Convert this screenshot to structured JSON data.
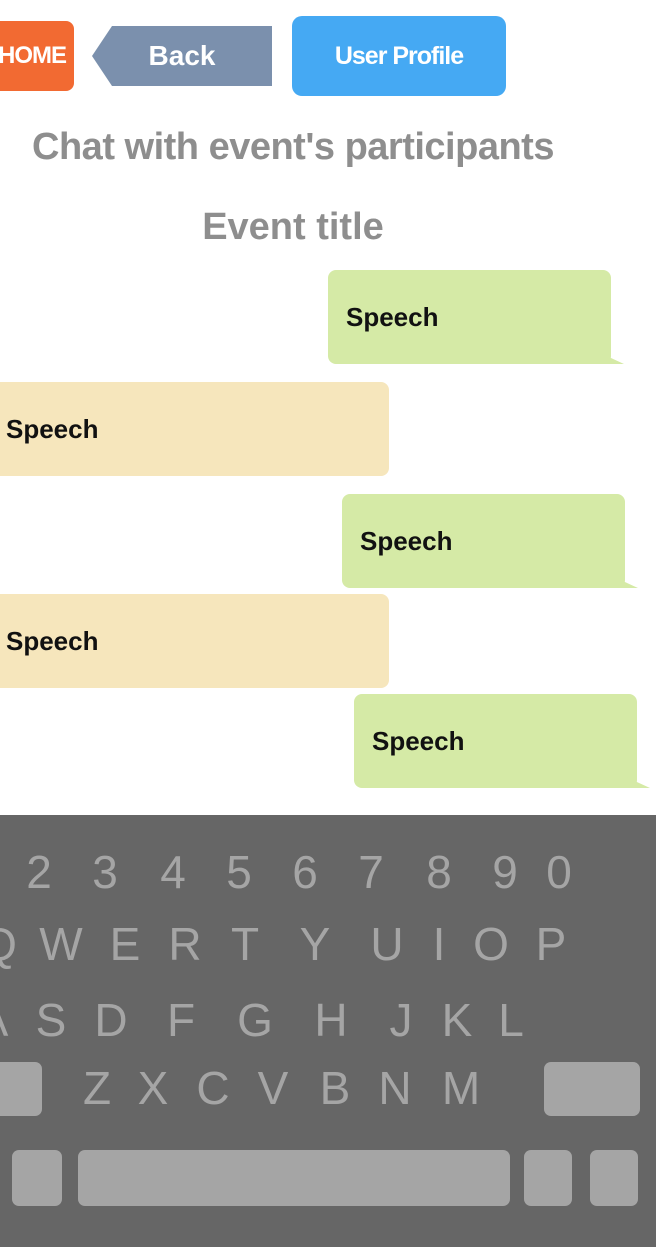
{
  "nav": {
    "home_label": "HOME",
    "back_label": "Back",
    "profile_label": "User Profile"
  },
  "header": {
    "title": "Chat with event's participants",
    "event_title": "Event title"
  },
  "messages": [
    {
      "side": "right",
      "text": "Speech"
    },
    {
      "side": "left",
      "text": "Speech"
    },
    {
      "side": "right",
      "text": "Speech"
    },
    {
      "side": "left",
      "text": "Speech"
    },
    {
      "side": "right",
      "text": "Speech"
    }
  ],
  "keyboard": {
    "row1": [
      "2",
      "3",
      "4",
      "5",
      "6",
      "7",
      "8",
      "9",
      "0"
    ],
    "row2": [
      "Q",
      "W",
      "E",
      "R",
      "T",
      "Y",
      "U",
      "I",
      "O",
      "P"
    ],
    "row3": [
      "A",
      "S",
      "D",
      "F",
      "G",
      "H",
      "J",
      "K",
      "L"
    ],
    "row4": [
      "Z",
      "X",
      "C",
      "V",
      "B",
      "N",
      "M"
    ]
  },
  "colors": {
    "home": "#f26a32",
    "back": "#7b90ad",
    "profile": "#45a9f3",
    "bubble_out": "#d5eaa6",
    "bubble_in": "#f6e6bc",
    "keyboard_bg": "#666666"
  }
}
